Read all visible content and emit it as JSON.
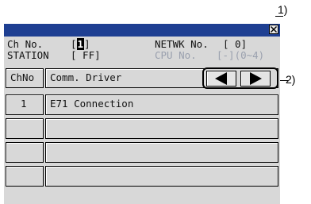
{
  "callouts": {
    "close": "1)",
    "nav": "2)"
  },
  "header": {
    "ch_no_label": "Ch No.",
    "ch_no_value": "1",
    "ch_no_open": "[",
    "ch_no_close": "]",
    "netwk_label": "NETWK No.",
    "netwk_value": "[ 0]",
    "station_label": "STATION",
    "station_value": "[ FF]",
    "cpu_label": "CPU No.",
    "cpu_value": "[-](0~4)"
  },
  "table": {
    "columns": [
      "ChNo",
      "Comm. Driver"
    ],
    "rows": [
      {
        "ch": "1",
        "driver": "E71 Connection"
      },
      {
        "ch": "",
        "driver": ""
      },
      {
        "ch": "",
        "driver": ""
      },
      {
        "ch": "",
        "driver": ""
      }
    ]
  },
  "nav": {
    "prev_icon": "triangle-left",
    "next_icon": "triangle-right"
  },
  "colors": {
    "titlebar": "#1e3f92",
    "panel": "#d8d8d8",
    "disabled_text": "#9aa0ae"
  }
}
